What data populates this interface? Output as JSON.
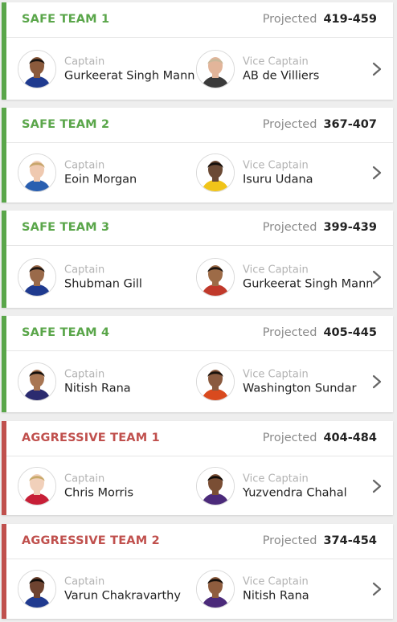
{
  "projected_label": "Projected",
  "captain_label": "Captain",
  "vice_captain_label": "Vice Captain",
  "colors": {
    "safe": "#5aa64a",
    "aggressive": "#c0504d",
    "background": "#eeeeee"
  },
  "teams": [
    {
      "name": "SAFE TEAM 1",
      "type": "safe",
      "projected": "419-459",
      "captain": {
        "name": "Gurkeerat Singh Mann",
        "avatar": "player-avatar"
      },
      "vice_captain": {
        "name": "AB de Villiers",
        "avatar": "player-avatar"
      }
    },
    {
      "name": "SAFE TEAM 2",
      "type": "safe",
      "projected": "367-407",
      "captain": {
        "name": "Eoin Morgan",
        "avatar": "player-avatar"
      },
      "vice_captain": {
        "name": "Isuru Udana",
        "avatar": "player-avatar"
      }
    },
    {
      "name": "SAFE TEAM 3",
      "type": "safe",
      "projected": "399-439",
      "captain": {
        "name": "Shubman Gill",
        "avatar": "player-avatar"
      },
      "vice_captain": {
        "name": "Gurkeerat Singh Mann",
        "avatar": "player-avatar"
      }
    },
    {
      "name": "SAFE TEAM 4",
      "type": "safe",
      "projected": "405-445",
      "captain": {
        "name": "Nitish Rana",
        "avatar": "player-avatar"
      },
      "vice_captain": {
        "name": "Washington Sundar",
        "avatar": "player-avatar"
      }
    },
    {
      "name": "AGGRESSIVE TEAM 1",
      "type": "aggressive",
      "projected": "404-484",
      "captain": {
        "name": "Chris Morris",
        "avatar": "player-avatar"
      },
      "vice_captain": {
        "name": "Yuzvendra Chahal",
        "avatar": "player-avatar"
      }
    },
    {
      "name": "AGGRESSIVE TEAM 2",
      "type": "aggressive",
      "projected": "374-454",
      "captain": {
        "name": "Varun Chakravarthy",
        "avatar": "player-avatar"
      },
      "vice_captain": {
        "name": "Nitish Rana",
        "avatar": "player-avatar"
      }
    }
  ]
}
